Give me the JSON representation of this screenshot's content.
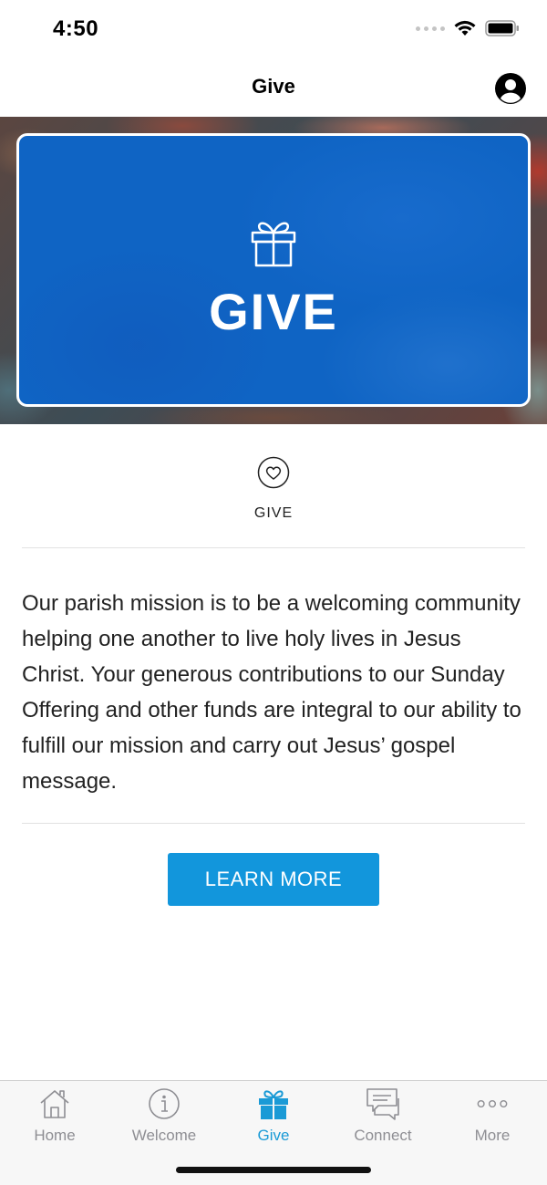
{
  "status_bar": {
    "time": "4:50"
  },
  "nav": {
    "title": "Give"
  },
  "banner": {
    "title": "GIVE"
  },
  "section": {
    "label": "GIVE"
  },
  "description": "Our parish mission is to be a welcoming community helping one another to live holy lives in Jesus Christ. Your generous contributions to our Sunday Offering and other funds are integral to our ability to fulfill our mission and carry out Jesus’ gospel message.",
  "cta": {
    "label": "LEARN MORE"
  },
  "colors": {
    "accent": "#1296dc",
    "banner_blue": "#0f64c4",
    "tab_active": "#1a9ad6",
    "tab_inactive": "#8e8e93"
  },
  "tabs": [
    {
      "label": "Home",
      "icon": "home-icon",
      "active": false
    },
    {
      "label": "Welcome",
      "icon": "info-icon",
      "active": false
    },
    {
      "label": "Give",
      "icon": "gift-icon",
      "active": true
    },
    {
      "label": "Connect",
      "icon": "chat-icon",
      "active": false
    },
    {
      "label": "More",
      "icon": "more-icon",
      "active": false
    }
  ]
}
